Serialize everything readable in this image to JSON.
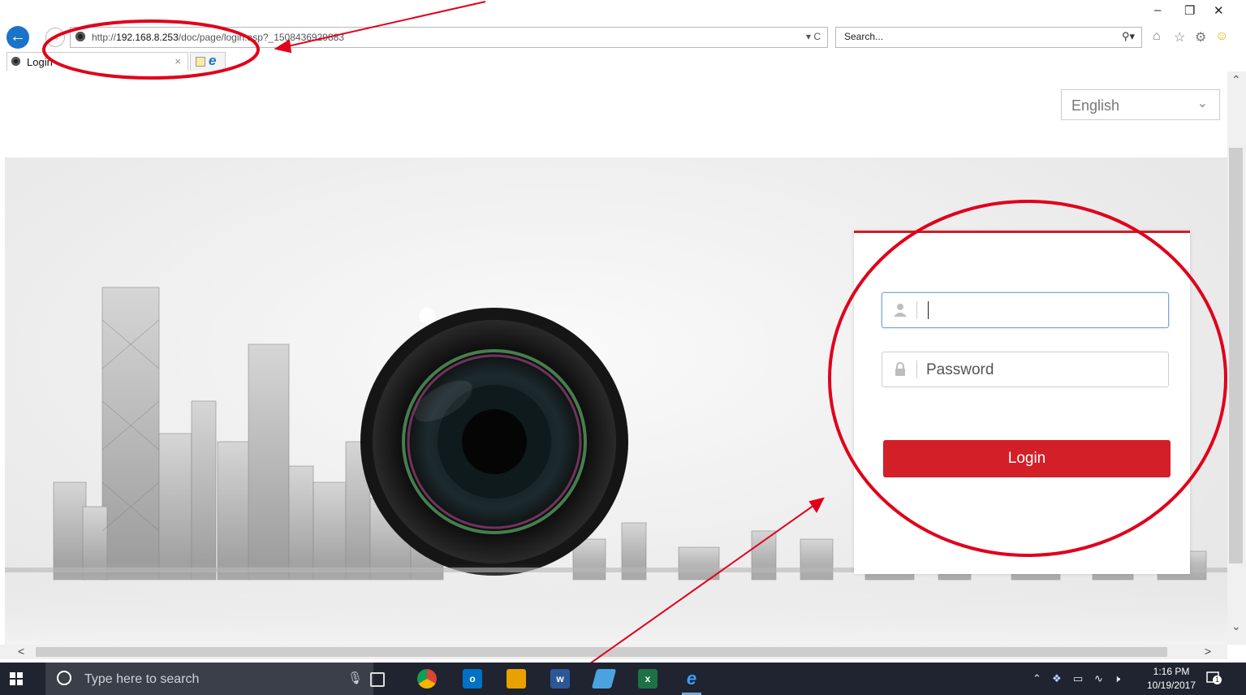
{
  "browser": {
    "url_prefix": "http://",
    "url_host": "192.168.8.253",
    "url_path": "/doc/page/login.asp?_1508436929883",
    "address_tools": "▾ C",
    "search_placeholder": "Search...",
    "tab_title": "Login",
    "tab_close": "×",
    "window_minimize": "–",
    "window_restore": "❐",
    "window_close": "✕"
  },
  "page": {
    "language_selected": "English",
    "username_placeholder": "",
    "password_placeholder": "Password",
    "login_label": "Login"
  },
  "taskbar": {
    "search_placeholder": "Type here to search",
    "time": "1:16 PM",
    "date": "10/19/2017",
    "notification_count": "1"
  },
  "colors": {
    "accent_red": "#d21f28",
    "card_top_border": "#cc1f2a",
    "annotation_red": "#e0001b",
    "back_button_blue": "#1a73c8"
  }
}
